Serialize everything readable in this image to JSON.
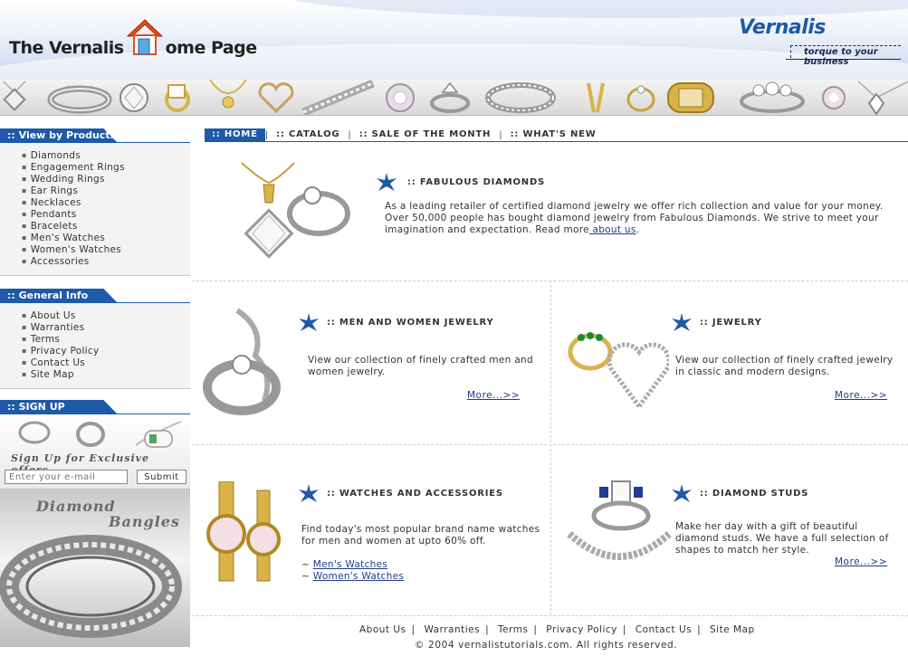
{
  "header": {
    "title_prefix": "The Vernalis",
    "title_suffix": "ome Page",
    "brand": "Vernalis",
    "tagline": "torque to your business"
  },
  "sidebar": {
    "products": {
      "heading": "::  View by Products",
      "items": [
        "Diamonds",
        "Engagement Rings",
        "Wedding Rings",
        "Ear Rings",
        "Necklaces",
        "Pendants",
        "Bracelets",
        "Men's Watches",
        "Women's Watches",
        "Accessories"
      ]
    },
    "general": {
      "heading": "::  General Info",
      "items": [
        "About Us",
        "Warranties",
        "Terms",
        "Privacy Policy",
        "Contact Us",
        "Site Map"
      ]
    },
    "signup": {
      "heading": "::  SIGN UP",
      "promo": "Sign Up for Exclusive offers",
      "email_placeholder": "Enter your e-mail",
      "submit_label": "Submit"
    },
    "banner": {
      "line1": "Diamond",
      "line2": "Bangles"
    }
  },
  "nav": {
    "items": [
      {
        "label": ":: HOME",
        "active": true
      },
      {
        "label": ":: CATALOG",
        "active": false
      },
      {
        "label": ":: SALE OF THE MONTH",
        "active": false
      },
      {
        "label": ":: WHAT'S NEW",
        "active": false
      }
    ]
  },
  "featured": {
    "title": ":: FABULOUS DIAMONDS",
    "body": "As a leading retailer of certified diamond jewelry we offer rich collection and value for your money. Over 50,000 people has bought diamond jewelry from Fabulous Diamonds.  We strive to meet your imagination and expectation.  Read more",
    "link": " about us",
    "after_link": "."
  },
  "sections": {
    "men_women": {
      "title": ":: MEN AND WOMEN JEWELRY",
      "body": "View our collection of finely crafted men and women jewelry.",
      "more": "More...>>"
    },
    "jewelry": {
      "title": ":: JEWELRY",
      "body": "View our collection of finely crafted jewelry in classic and modern designs.",
      "more": "More...>>"
    },
    "watches": {
      "title": ":: WATCHES AND ACCESSORIES",
      "body": "Find today's most popular brand name watches for men and women at upto 60% off.",
      "link1": "Men's Watches",
      "link2": "Women's Watches",
      "prefix": "~"
    },
    "studs": {
      "title": ":: DIAMOND STUDS",
      "body": "Make her day with a gift of beautiful diamond studs.  We have a full selection of shapes to match her style.",
      "more": "More...>>"
    }
  },
  "footer": {
    "links": [
      "About Us",
      "Warranties",
      "Terms",
      "Privacy Policy",
      "Contact Us",
      "Site Map"
    ],
    "copyright": "© 2004 vernalistutorials.com. All rights reserved."
  },
  "colors": {
    "accent": "#1e5aa8",
    "link": "#1e3c8c",
    "gold": "#d9b24a"
  }
}
